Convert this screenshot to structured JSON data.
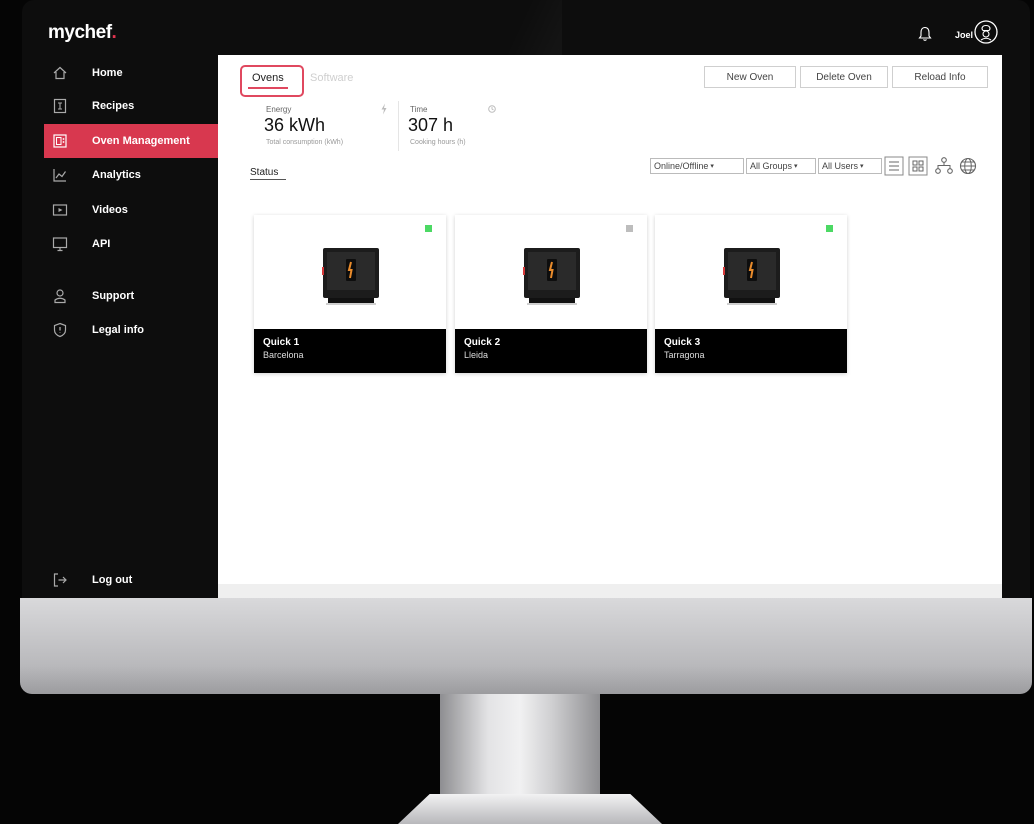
{
  "app": {
    "logo_text": "mychef",
    "logo_dot": ".",
    "accent_color": "#d8384f"
  },
  "header": {
    "user_name": "Joel",
    "bell_icon": "bell-icon",
    "avatar_icon": "chef-avatar-icon"
  },
  "sidebar": {
    "items": [
      {
        "label": "Home",
        "icon": "home-icon"
      },
      {
        "label": "Recipes",
        "icon": "recipes-icon"
      },
      {
        "label": "Oven Management",
        "icon": "oven-management-icon",
        "active": true
      },
      {
        "label": "Analytics",
        "icon": "analytics-icon"
      },
      {
        "label": "Videos",
        "icon": "videos-icon"
      },
      {
        "label": "API",
        "icon": "api-icon"
      },
      {
        "label": "Support",
        "icon": "support-icon"
      },
      {
        "label": "Legal info",
        "icon": "legal-icon"
      }
    ],
    "logout": {
      "label": "Log out",
      "icon": "logout-icon"
    }
  },
  "main": {
    "tabs": [
      {
        "label": "Ovens",
        "active": true
      },
      {
        "label": "Software"
      }
    ],
    "actions": {
      "new_oven": "New Oven",
      "delete_oven": "Delete Oven",
      "reload_info": "Reload Info"
    },
    "stats": [
      {
        "label": "Energy",
        "value": "36 kWh",
        "sub": "Total consumption (kWh)"
      },
      {
        "label": "Time",
        "value": "307 h",
        "sub": "Cooking hours (h)"
      }
    ],
    "status_tab": "Status",
    "filters": {
      "online": "Online/Offline",
      "groups": "All Groups",
      "users": "All Users"
    },
    "ovens": [
      {
        "name": "Quick 1",
        "city": "Barcelona",
        "status_color": "#4cd964"
      },
      {
        "name": "Quick 2",
        "city": "Lleida",
        "status_color": "#bdbdbd"
      },
      {
        "name": "Quick 3",
        "city": "Tarragona",
        "status_color": "#4cd964"
      }
    ]
  }
}
